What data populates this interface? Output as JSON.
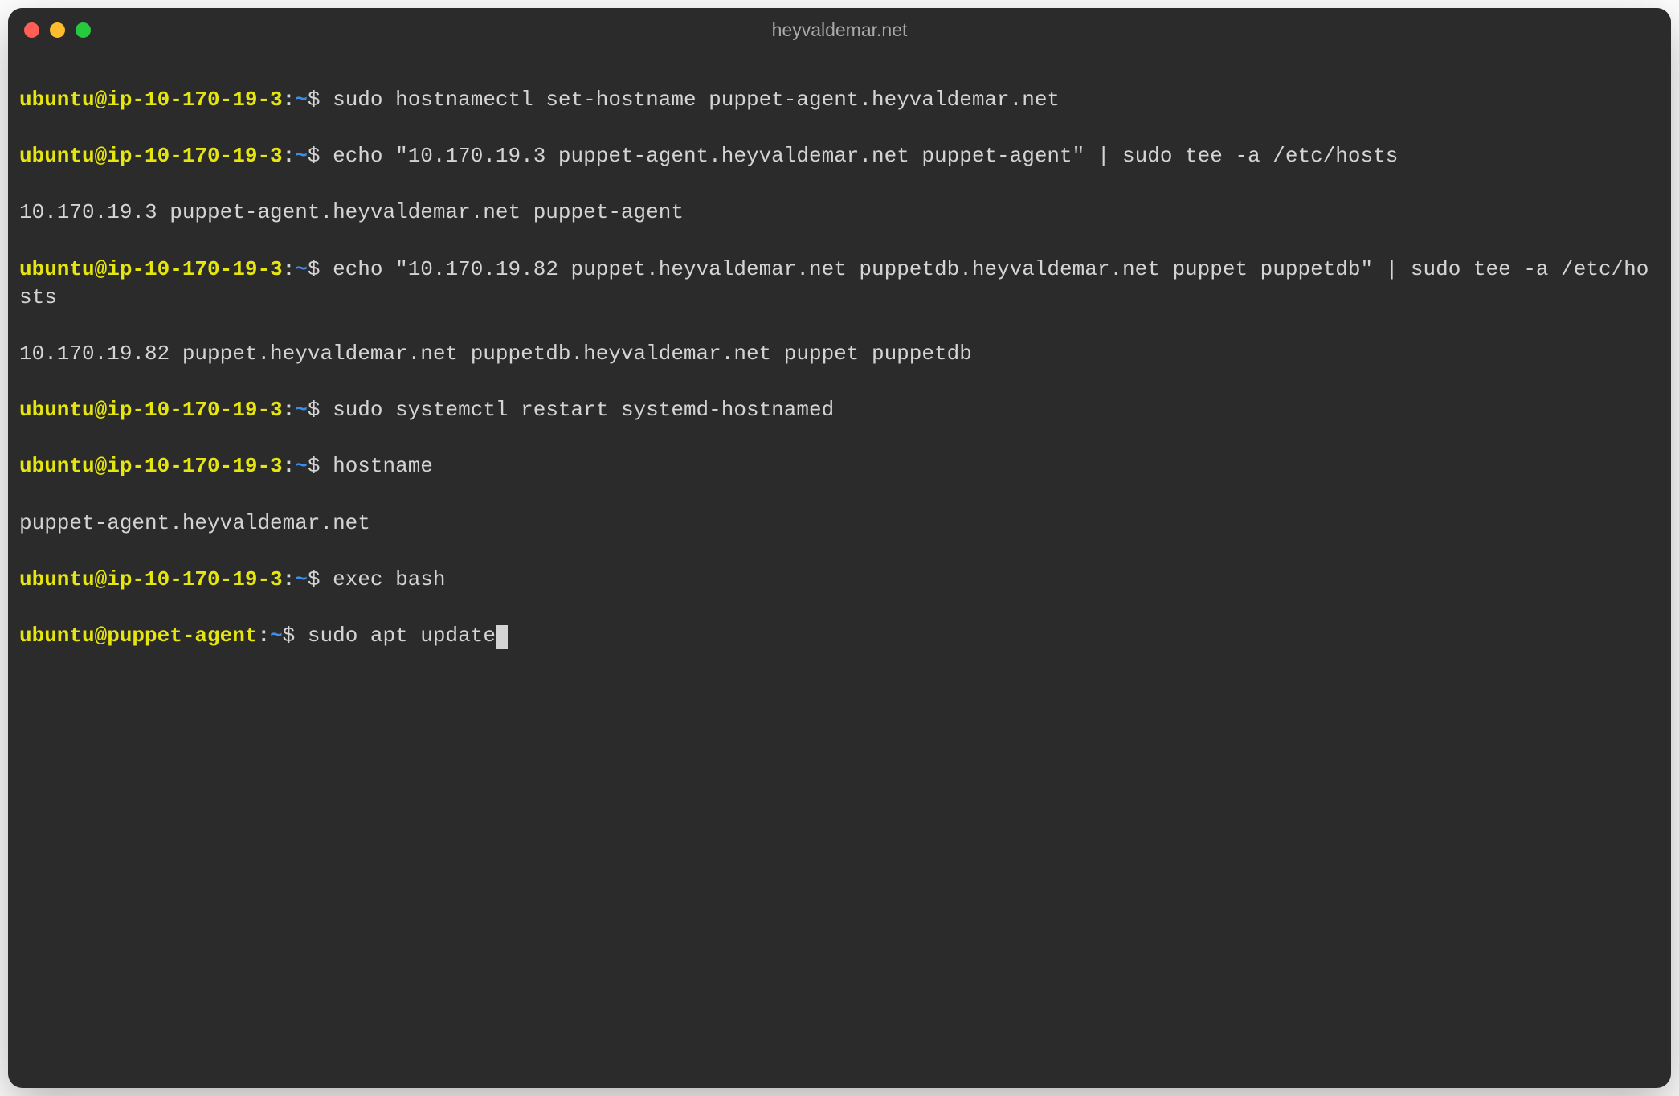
{
  "window": {
    "title": "heyvaldemar.net"
  },
  "prompts": {
    "p1": "ubuntu@ip-10-170-19-3",
    "p2": "ubuntu@puppet-agent",
    "path": "~",
    "colon": ":",
    "dollar": "$"
  },
  "lines": {
    "cmd1": " sudo hostnamectl set-hostname puppet-agent.heyvaldemar.net",
    "cmd2": " echo \"10.170.19.3 puppet-agent.heyvaldemar.net puppet-agent\" | sudo tee -a /etc/hosts",
    "out2": "10.170.19.3 puppet-agent.heyvaldemar.net puppet-agent",
    "cmd3": " echo \"10.170.19.82 puppet.heyvaldemar.net puppetdb.heyvaldemar.net puppet puppetdb\" | sudo tee -a /etc/hosts",
    "out3": "10.170.19.82 puppet.heyvaldemar.net puppetdb.heyvaldemar.net puppet puppetdb",
    "cmd4": " sudo systemctl restart systemd-hostnamed",
    "cmd5": " hostname",
    "out5": "puppet-agent.heyvaldemar.net",
    "cmd6": " exec bash",
    "cmd7": " sudo apt update"
  }
}
